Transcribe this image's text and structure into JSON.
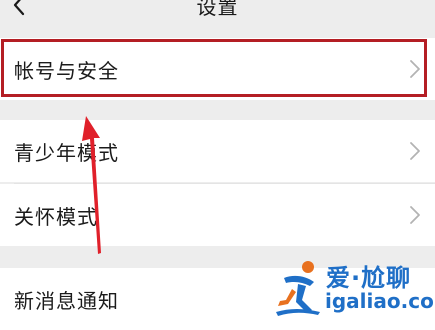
{
  "header": {
    "title": "设置",
    "back_icon": "chevron-left-icon"
  },
  "settings": {
    "items": [
      {
        "label": "帐号与安全"
      },
      {
        "label": "青少年模式"
      },
      {
        "label": "关怀模式"
      },
      {
        "label": "新消息通知"
      }
    ]
  },
  "annotation": {
    "highlight_color": "#b41e24",
    "arrow_color": "#e0202a"
  },
  "watermark": {
    "line1": "爱·尬聊",
    "line2": "igaliao.com",
    "color": "#1f6fc7"
  }
}
